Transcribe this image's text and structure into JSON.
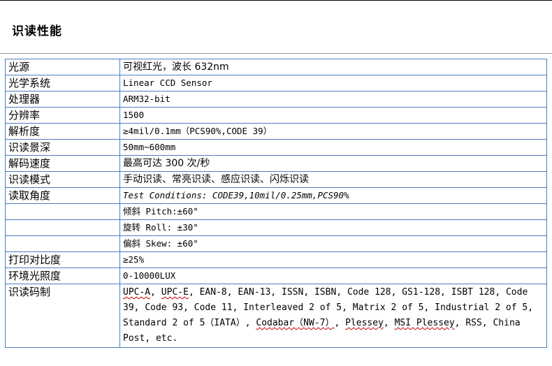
{
  "document": {
    "heading": "识读性能"
  },
  "spec_table": {
    "rows": [
      {
        "label": "光源",
        "value": "可视红光，波长 632nm"
      },
      {
        "label": "光学系统",
        "value": "Linear CCD Sensor"
      },
      {
        "label": "处理器",
        "value": "ARM32-bit"
      },
      {
        "label": "分辨率",
        "value": "1500"
      },
      {
        "label": "解析度",
        "value": "≥4mil/0.1mm（PCS90%,CODE 39）"
      },
      {
        "label": "识读景深",
        "value": "50mm~600mm"
      },
      {
        "label": "解码速度",
        "value": "最高可达 300 次/秒"
      },
      {
        "label": "识读模式",
        "value": "手动识读、常亮识读、感应识读、闪烁识读"
      },
      {
        "label": "读取角度",
        "value": "Test Conditions: CODE39,10mil/0.25mm,PCS90%"
      },
      {
        "label": "",
        "value": "倾斜 Pitch:±60°"
      },
      {
        "label": "",
        "value": "旋转 Roll: ±30°"
      },
      {
        "label": "",
        "value": "偏斜 Skew: ±60°"
      },
      {
        "label": "打印对比度",
        "value": "≥25%"
      },
      {
        "label": "环境光照度",
        "value": "0-10000LUX"
      }
    ],
    "symbologies": {
      "label": "识读码制",
      "items": [
        "UPC-A",
        "UPC-E",
        "EAN-8",
        "EAN-13",
        "ISSN",
        "ISBN",
        "Code 128",
        "GS1-128",
        "ISBT 128",
        "Code 39",
        "Code 93",
        "Code 11",
        "Interleaved 2 of 5",
        "Matrix 2 of 5",
        "Industrial 2 of 5",
        "Standard 2 of 5（IATA）",
        "Codabar（NW-7）",
        "Plessey",
        "MSI Plessey",
        "RSS",
        "China Post",
        "etc."
      ]
    }
  },
  "colors": {
    "table_border": "#4b7fc0",
    "spellcheck_underline": "#c00000"
  }
}
